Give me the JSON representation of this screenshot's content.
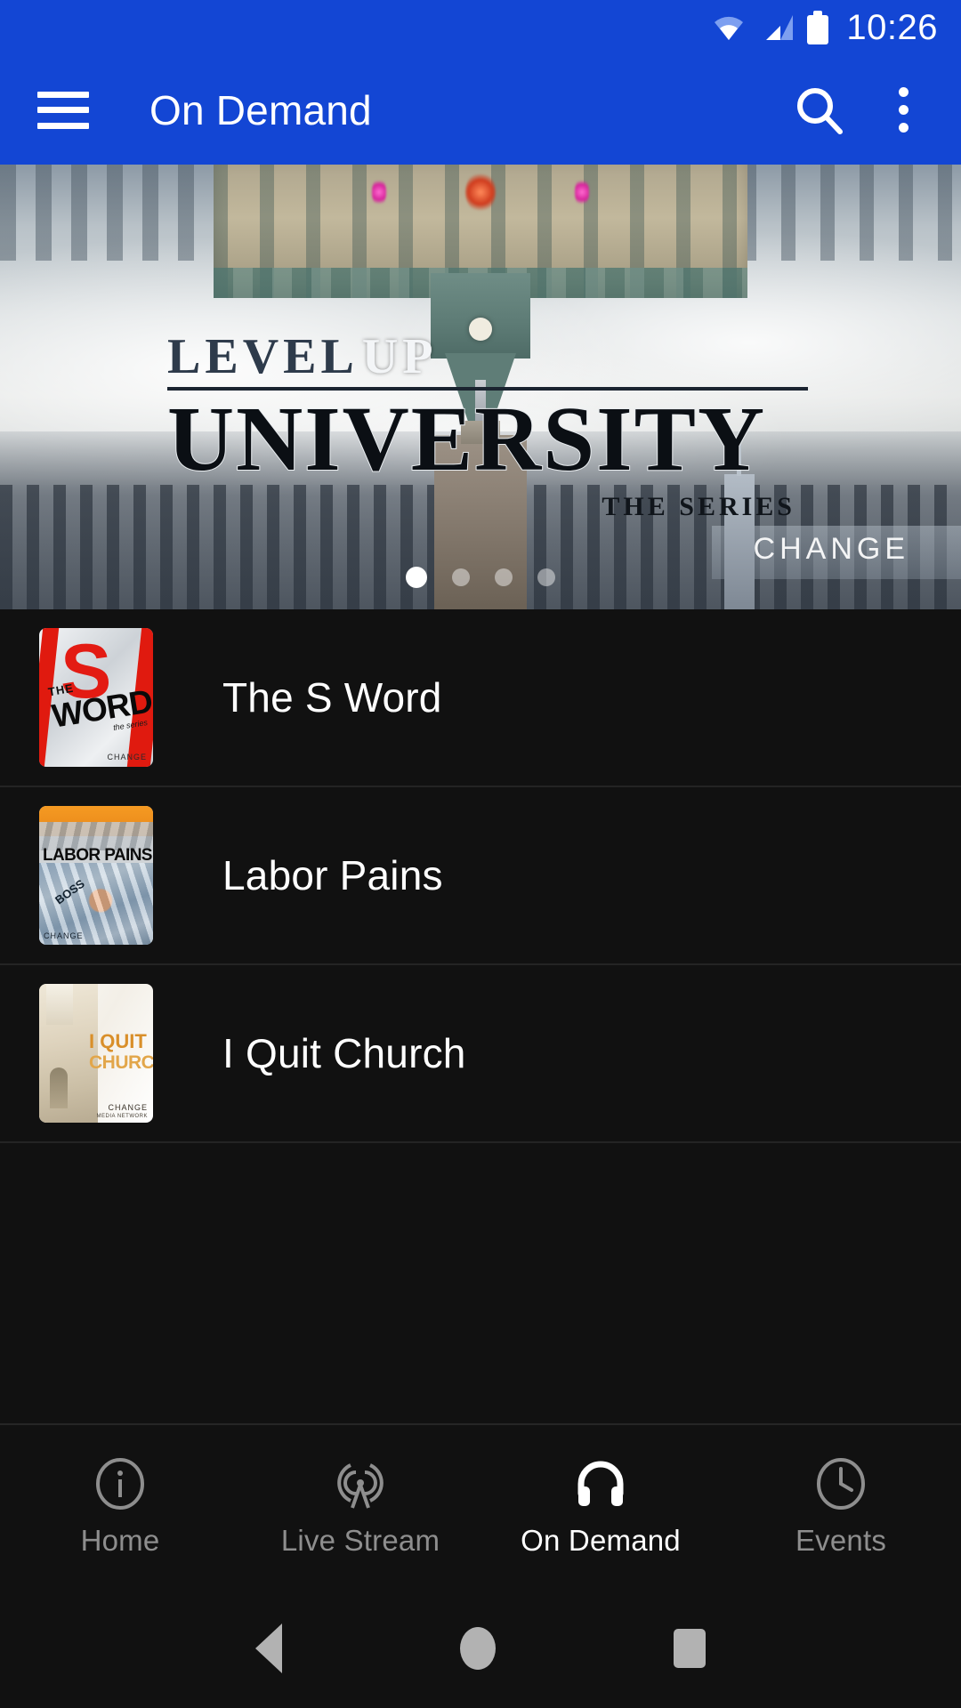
{
  "status_bar": {
    "time": "10:26",
    "wifi_icon": "wifi-icon",
    "signal_icon": "cell-signal-icon",
    "battery_icon": "battery-full-icon"
  },
  "app_bar": {
    "menu_icon": "hamburger-menu-icon",
    "title": "On Demand",
    "search_icon": "search-icon",
    "overflow_icon": "overflow-menu-icon",
    "background_color": "#1346d4"
  },
  "hero": {
    "title_line1_a": "LEVEL",
    "title_line1_b": "UP",
    "title_line2": "UNIVERSITY",
    "subtitle": "THE SERIES",
    "watermark": "CHANGE",
    "dots_total": 4,
    "active_dot": 1
  },
  "list": {
    "items": [
      {
        "title": "The S Word",
        "thumb": {
          "big_letter": "S",
          "the": "THE",
          "word": "WORD",
          "series": "the series",
          "logo": "CHANGE"
        }
      },
      {
        "title": "Labor Pains",
        "thumb": {
          "headline": "LABOR PAINS",
          "sign": "BOSS",
          "logo": "CHANGE"
        }
      },
      {
        "title": "I Quit Church",
        "thumb": {
          "line1": "I QUIT",
          "line2": "CHURCH",
          "logo": "CHANGE",
          "logo_sub": "MEDIA NETWORK"
        }
      }
    ]
  },
  "bottom_nav": {
    "items": [
      {
        "label": "Home",
        "icon": "info-circle-icon",
        "active": false
      },
      {
        "label": "Live Stream",
        "icon": "broadcast-tower-icon",
        "active": false
      },
      {
        "label": "On Demand",
        "icon": "headphones-icon",
        "active": true
      },
      {
        "label": "Events",
        "icon": "clock-icon",
        "active": false
      }
    ],
    "active_color": "#ffffff",
    "inactive_color": "#8e8e8e"
  },
  "system_nav": {
    "back_icon": "back-triangle-icon",
    "home_icon": "home-circle-icon",
    "recents_icon": "recents-square-icon"
  }
}
